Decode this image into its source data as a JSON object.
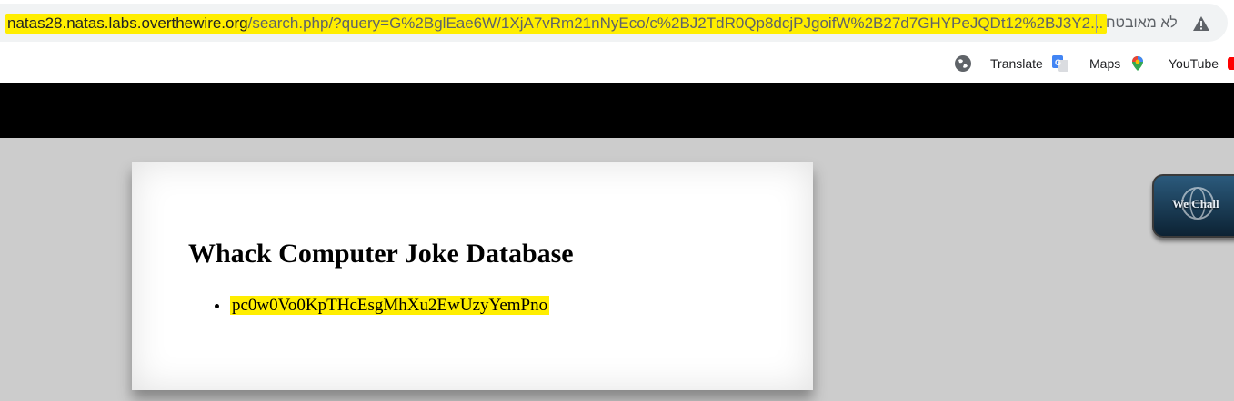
{
  "browser": {
    "url_host": "natas28.natas.labs.overthewire.org",
    "url_rest": "/search.php/?query=G%2BglEae6W/1XjA7vRm21nNyEco/c%2BJ2TdR0Qp8dcjPJgoifW%2B27d7GHYPeJQDt12%2BJ3Y2...",
    "security_label": "לא מאובטח",
    "security_icon": "warning-triangle-icon"
  },
  "bookmarks": [
    {
      "label": "Translate",
      "icon": "google-translate-icon"
    },
    {
      "label": "Maps",
      "icon": "google-maps-icon"
    },
    {
      "label": "YouTube",
      "icon": "youtube-icon"
    }
  ],
  "page": {
    "heading": "Whack Computer Joke Database",
    "results": [
      "pc0w0Vo0KpTHcEsgMhXu2EwUzyYemPno"
    ]
  },
  "badge": {
    "label": "We Chall"
  }
}
